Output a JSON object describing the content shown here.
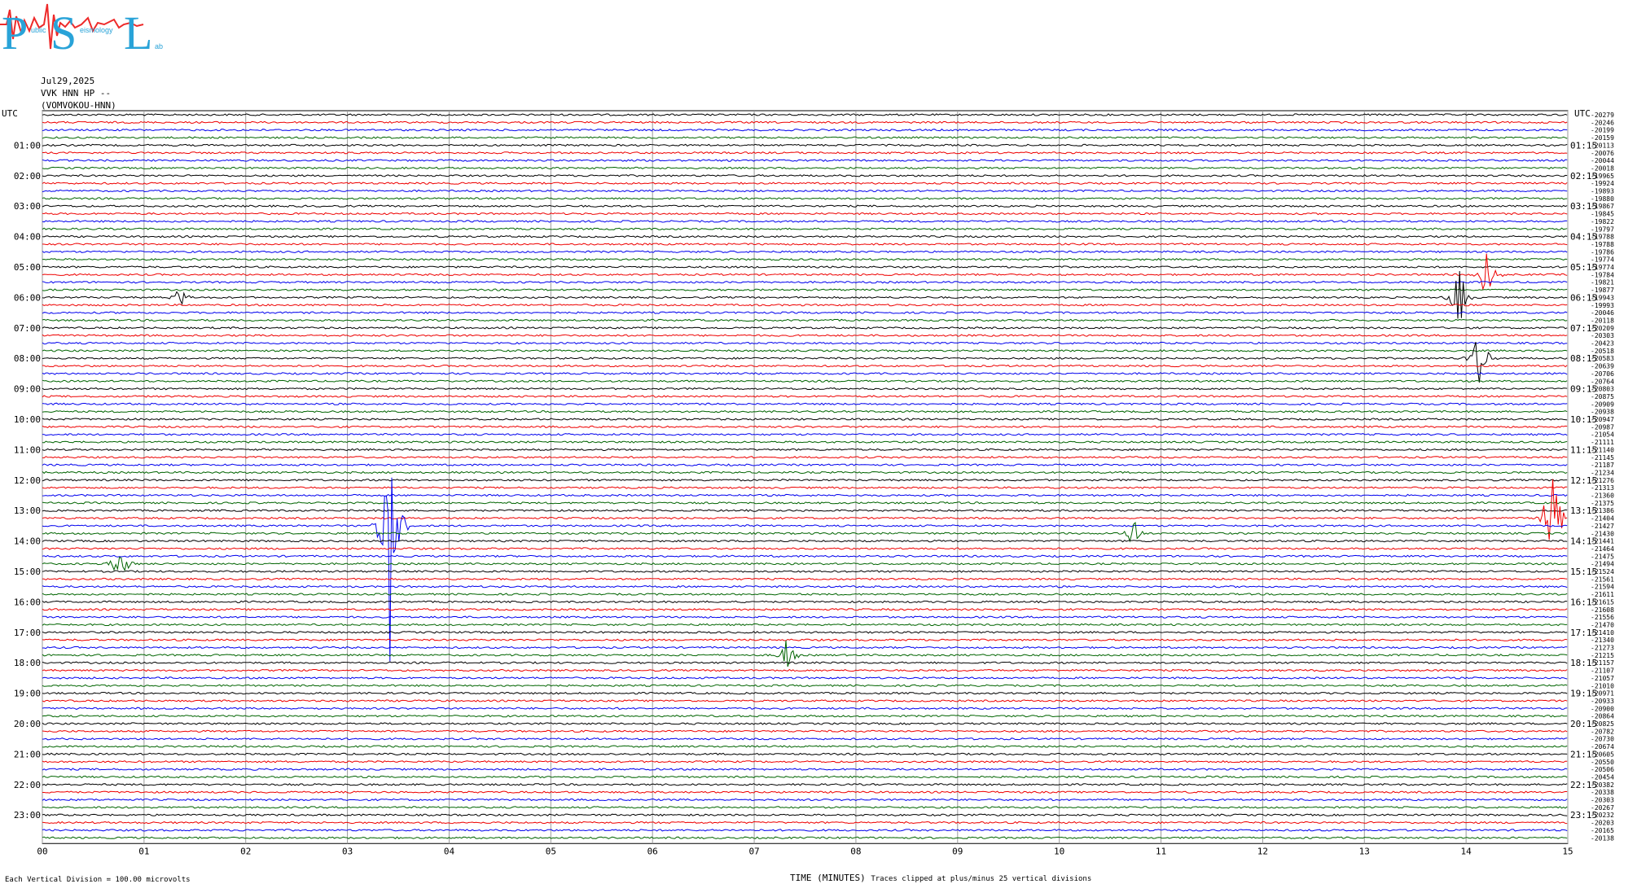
{
  "logo": {
    "letters": [
      "P",
      "S",
      "L"
    ],
    "tagline_parts": [
      "ublic",
      "eismology",
      "ab"
    ],
    "colors": {
      "letters": "#29a3d8",
      "wave": "#ee2a2a"
    }
  },
  "header": {
    "date": "Jul29,2025",
    "station": "VVK HNN HP --",
    "site": "(VOMVOKOU-HNN)"
  },
  "chart_data": {
    "type": "line",
    "title": "",
    "xlabel": "TIME (MINUTES)",
    "left_axis_label": "UTC",
    "right_axis_label": "UTC",
    "x_ticks": [
      "00",
      "01",
      "02",
      "03",
      "04",
      "05",
      "06",
      "07",
      "08",
      "09",
      "10",
      "11",
      "12",
      "13",
      "14",
      "15"
    ],
    "xlim": [
      0,
      15
    ],
    "trace_colors": [
      "#000000",
      "#ee0000",
      "#0000ee",
      "#006400"
    ],
    "trace_count": 96,
    "left_hour_labels": [
      "01:00",
      "02:00",
      "03:00",
      "04:00",
      "05:00",
      "06:00",
      "07:00",
      "08:00",
      "09:00",
      "10:00",
      "11:00",
      "12:00",
      "13:00",
      "14:00",
      "15:00",
      "16:00",
      "17:00",
      "18:00",
      "19:00",
      "20:00",
      "21:00",
      "22:00",
      "23:00"
    ],
    "right_hour_labels": [
      "01:15",
      "02:15",
      "03:15",
      "04:15",
      "05:15",
      "06:15",
      "07:15",
      "08:15",
      "09:15",
      "10:15",
      "11:15",
      "12:15",
      "13:15",
      "14:15",
      "15:15",
      "16:15",
      "17:15",
      "18:15",
      "19:15",
      "20:15",
      "21:15",
      "22:15",
      "23:15"
    ],
    "trace_offsets": [
      "-20279",
      "-20246",
      "-20199",
      "-20159",
      "-20113",
      "-20076",
      "-20044",
      "-20018",
      "-19965",
      "-19924",
      "-19893",
      "-19880",
      "-19867",
      "-19845",
      "-19822",
      "-19797",
      "-19788",
      "-19788",
      "-19786",
      "-19774",
      "-19774",
      "-19784",
      "-19821",
      "-19877",
      "-19943",
      "-19993",
      "-20046",
      "-20118",
      "-20209",
      "-20303",
      "-20423",
      "-20518",
      "-20583",
      "-20639",
      "-20706",
      "-20764",
      "-20803",
      "-20875",
      "-20909",
      "-20938",
      "-20947",
      "-20987",
      "-21054",
      "-21111",
      "-21140",
      "-21145",
      "-21187",
      "-21234",
      "-21276",
      "-21313",
      "-21360",
      "-21375",
      "-21386",
      "-21404",
      "-21427",
      "-21430",
      "-21441",
      "-21464",
      "-21475",
      "-21494",
      "-21524",
      "-21561",
      "-21594",
      "-21611",
      "-21615",
      "-21608",
      "-21556",
      "-21470",
      "-21410",
      "-21340",
      "-21273",
      "-21215",
      "-21157",
      "-21107",
      "-21057",
      "-21010",
      "-20971",
      "-20933",
      "-20900",
      "-20864",
      "-20825",
      "-20782",
      "-20730",
      "-20674",
      "-20605",
      "-20550",
      "-20506",
      "-20454",
      "-20382",
      "-20338",
      "-20303",
      "-20267",
      "-20232",
      "-20203",
      "-20165",
      "-20138"
    ],
    "events": [
      {
        "trace": 24,
        "minute": 13.93,
        "amplitude_divisions": 5
      },
      {
        "trace": 21,
        "minute": 14.2,
        "amplitude_divisions": 4
      },
      {
        "trace": 32,
        "minute": 14.13,
        "amplitude_divisions": 5
      },
      {
        "trace": 54,
        "minute": 3.42,
        "amplitude_divisions": 25
      },
      {
        "trace": 53,
        "minute": 14.85,
        "amplitude_divisions": 12
      },
      {
        "trace": 55,
        "minute": 10.72,
        "amplitude_divisions": 3
      },
      {
        "trace": 59,
        "minute": 0.77,
        "amplitude_divisions": 3
      },
      {
        "trace": 71,
        "minute": 7.32,
        "amplitude_divisions": 2.5
      },
      {
        "trace": 24,
        "minute": 1.35,
        "amplitude_divisions": 1.5
      }
    ],
    "grid": true
  },
  "footer": {
    "vertical_division": "Each Vertical Division =  100.00 microvolts",
    "clip_note": "Traces clipped at plus/minus 25 vertical divisions"
  }
}
